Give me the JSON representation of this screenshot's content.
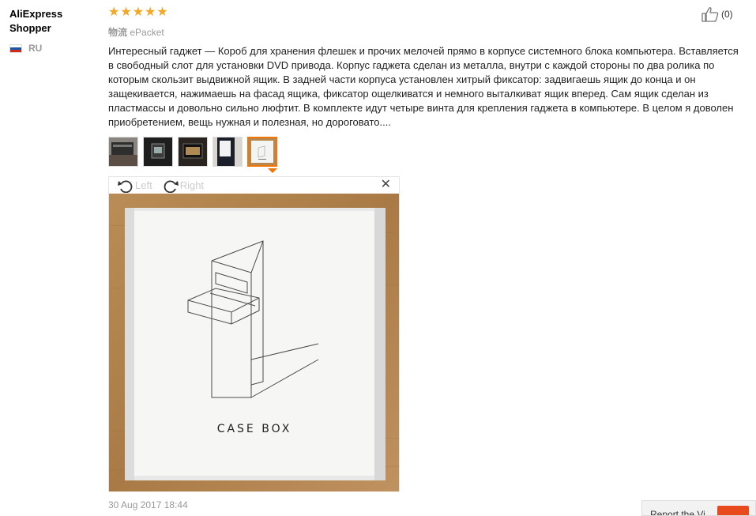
{
  "reviewer": {
    "name": "AliExpress Shopper",
    "country_code": "RU"
  },
  "rating": {
    "stars": 5,
    "max": 5,
    "star_glyph": "★",
    "color": "#f5a623"
  },
  "shipping": {
    "label": "物流",
    "method": "ePacket"
  },
  "helpful": {
    "icon": "thumbs-up-icon",
    "count_text": "(0)"
  },
  "review_text": "Интересный гаджет — Короб для хранения флешек и прочих мелочей прямо в корпусе системного блока компьютера. Вставляется в свободный слот для установки DVD привода. Корпус гаджета сделан из металла, внутри с каждой стороны по два ролика по которым скользит выдвижной ящик. В задней части корпуса установлен хитрый фиксатор: задвигаешь ящик до конца и он защекивается, нажимаешь на фасад ящика, фиксатор ощелкиватся и немного выталкиват ящик вперед. Сам ящик сделан из пластмассы и довольно сильно люфтит. В комплекте идут четыре винта для крепления гаджета в компьютере. В целом я доволен приобретением, вещь нужная и полезная, но дороговато....",
  "thumbnails": [
    {
      "name": "photo-1",
      "active": false
    },
    {
      "name": "photo-2",
      "active": false
    },
    {
      "name": "photo-3",
      "active": false
    },
    {
      "name": "photo-4",
      "active": false
    },
    {
      "name": "photo-5",
      "active": true
    }
  ],
  "viewer": {
    "rotate_left_label": "Left",
    "rotate_right_label": "Right",
    "close_glyph": "✕",
    "box_text": "CASE BOX"
  },
  "timestamp": "30 Aug 2017 18:44",
  "bottom_button": {
    "label": "Report the Vi"
  },
  "colors": {
    "accent": "#f0760a",
    "flag_white": "#ffffff",
    "flag_blue": "#1c57a7",
    "flag_red": "#d52b1e"
  }
}
